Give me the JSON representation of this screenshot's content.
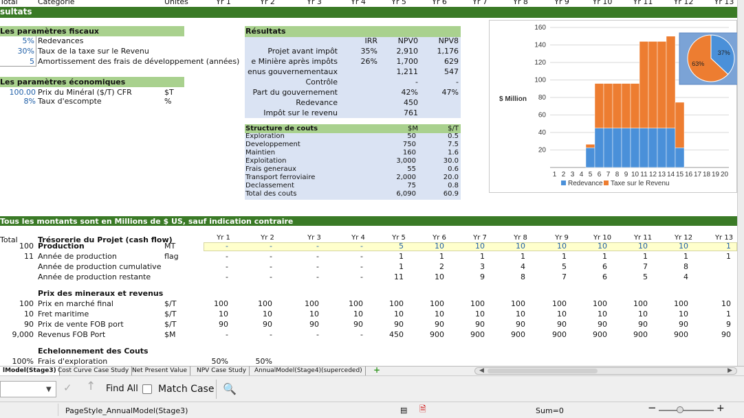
{
  "header_row": {
    "c0": "Total",
    "c1": "Catégorie",
    "c2": "Unités",
    "years": [
      "Yr 1",
      "Yr 2",
      "Yr 3",
      "Yr 4",
      "Yr 5",
      "Yr 6",
      "Yr 7",
      "Yr 8",
      "Yr 9",
      "Yr 10",
      "Yr 11",
      "Yr 12",
      "Yr 13"
    ]
  },
  "sheet": {
    "section_title": "sultats",
    "units_note": "Tous les montants sont en Millions de $ US, sauf indication contraire"
  },
  "fiscal": {
    "title": "Les paramètres fiscaux",
    "rows": [
      {
        "value": "5%",
        "label": "Redevances"
      },
      {
        "value": "30%",
        "label": "Taux de la taxe sur le Revenu"
      },
      {
        "value": "5",
        "label": "Amortissement des frais de développement (années)"
      }
    ]
  },
  "economic": {
    "title": "Les paramètres économiques",
    "rows": [
      {
        "value": "100.00",
        "label": "Prix du Minéral ($/T) CFR",
        "unit": "$T"
      },
      {
        "value": "8%",
        "label": "Taux d'escompte",
        "unit": "%"
      }
    ]
  },
  "results": {
    "title": "Résultats",
    "headers": [
      "IRR",
      "NPV0",
      "NPV8"
    ],
    "rows": [
      {
        "label": "Projet avant impôt",
        "irr": "35%",
        "npv0": "2,910",
        "npv8": "1,176"
      },
      {
        "label": "e Minière après impôts",
        "irr": "26%",
        "npv0": "1,700",
        "npv8": "629"
      },
      {
        "label": "enus gouvernementaux",
        "irr": "",
        "npv0": "1,211",
        "npv8": "547"
      },
      {
        "label": "Contrôle",
        "irr": "",
        "npv0": "-",
        "npv8": "-"
      },
      {
        "label": "Part du gouvernement",
        "irr": "",
        "npv0": "42%",
        "npv8": "47%"
      },
      {
        "label": "Redevance",
        "irr": "",
        "npv0": "450",
        "npv8": ""
      },
      {
        "label": "Impôt sur le revenu",
        "irr": "",
        "npv0": "761",
        "npv8": ""
      }
    ]
  },
  "costs": {
    "title": "Structure de couts",
    "headers": [
      "$M",
      "$/T"
    ],
    "rows": [
      {
        "label": "Exploration",
        "m": "50",
        "t": "0.5"
      },
      {
        "label": "Developpement",
        "m": "750",
        "t": "7.5"
      },
      {
        "label": "Maintien",
        "m": "160",
        "t": "1.6"
      },
      {
        "label": "Exploitation",
        "m": "3,000",
        "t": "30.0"
      },
      {
        "label": "Frais generaux",
        "m": "55",
        "t": "0.6"
      },
      {
        "label": "Transport ferroviaire",
        "m": "2,000",
        "t": "20.0"
      },
      {
        "label": "Declassement",
        "m": "75",
        "t": "0.8"
      },
      {
        "label": "Total des couts",
        "m": "6,090",
        "t": "60.9"
      }
    ]
  },
  "cashflow": {
    "title": "Trésorerie du Projet (cash flow)",
    "total_header": "Total",
    "rows": [
      {
        "total": "100",
        "label": "Production",
        "unit": "MT",
        "bold": true,
        "yellow": true,
        "values": [
          "-",
          "-",
          "-",
          "-",
          "5",
          "10",
          "10",
          "10",
          "10",
          "10",
          "10",
          "10",
          "1"
        ]
      },
      {
        "total": "11",
        "label": "Année de production",
        "unit": "flag",
        "values": [
          "-",
          "-",
          "-",
          "-",
          "1",
          "1",
          "1",
          "1",
          "1",
          "1",
          "1",
          "1",
          "1"
        ]
      },
      {
        "total": "",
        "label": "Année de production cumulative",
        "unit": "",
        "values": [
          "-",
          "-",
          "-",
          "-",
          "1",
          "2",
          "3",
          "4",
          "5",
          "6",
          "7",
          "8",
          ""
        ]
      },
      {
        "total": "",
        "label": "Année de production restante",
        "unit": "",
        "values": [
          "-",
          "-",
          "-",
          "-",
          "11",
          "10",
          "9",
          "8",
          "7",
          "6",
          "5",
          "4",
          ""
        ]
      },
      {
        "total": "",
        "label": "Prix des mineraux et revenus",
        "unit": "",
        "bold": true,
        "values": []
      },
      {
        "total": "100",
        "label": "Prix en marché final",
        "unit": "$/T",
        "values": [
          "100",
          "100",
          "100",
          "100",
          "100",
          "100",
          "100",
          "100",
          "100",
          "100",
          "100",
          "100",
          "10"
        ]
      },
      {
        "total": "10",
        "label": "Fret maritime",
        "unit": "$/T",
        "values": [
          "10",
          "10",
          "10",
          "10",
          "10",
          "10",
          "10",
          "10",
          "10",
          "10",
          "10",
          "10",
          "1"
        ]
      },
      {
        "total": "90",
        "label": "Prix de vente FOB port",
        "unit": "$/T",
        "values": [
          "90",
          "90",
          "90",
          "90",
          "90",
          "90",
          "90",
          "90",
          "90",
          "90",
          "90",
          "90",
          "9"
        ]
      },
      {
        "total": "9,000",
        "label": "Revenus FOB Port",
        "unit": "$M",
        "values": [
          "-",
          "-",
          "-",
          "-",
          "450",
          "900",
          "900",
          "900",
          "900",
          "900",
          "900",
          "900",
          "90"
        ]
      },
      {
        "total": "",
        "label": "Echelonnement des Couts",
        "unit": "",
        "bold": true,
        "values": []
      },
      {
        "total": "100%",
        "label": "Frais d'exploration",
        "unit": "",
        "values": [
          "50%",
          "50%"
        ]
      }
    ]
  },
  "chart_data": {
    "type": "bar",
    "stacked": true,
    "title": "",
    "ylabel": "$ Million",
    "ylim": [
      0,
      160
    ],
    "yticks": [
      20,
      40,
      60,
      80,
      100,
      120,
      140,
      160
    ],
    "categories": [
      "1",
      "2",
      "3",
      "4",
      "5",
      "6",
      "7",
      "8",
      "9",
      "10",
      "11",
      "12",
      "13",
      "14",
      "15",
      "16",
      "17",
      "18",
      "19",
      "20"
    ],
    "series": [
      {
        "name": "Redevance",
        "color": "#4a90d9",
        "values": [
          0,
          0,
          0,
          0,
          22.5,
          45,
          45,
          45,
          45,
          45,
          45,
          45,
          45,
          45,
          22.5,
          0,
          0,
          0,
          0,
          0
        ]
      },
      {
        "name": "Taxe sur le Revenu",
        "color": "#ed7d31",
        "values": [
          0,
          0,
          0,
          0,
          4,
          51,
          51,
          51,
          51,
          51,
          99,
          99,
          99,
          105,
          52,
          0,
          0,
          0,
          0,
          0
        ]
      }
    ],
    "legend": "bottom",
    "grid": true,
    "pie": {
      "slices": [
        {
          "label": "37%",
          "value": 37,
          "color": "#4a90d9"
        },
        {
          "label": "63%",
          "value": 63,
          "color": "#ed7d31"
        }
      ]
    }
  },
  "tabs": [
    {
      "label": "lModel(Stage3)",
      "active": true
    },
    {
      "label": "Cost Curve Case Study"
    },
    {
      "label": "Net Present Value"
    },
    {
      "label": "NPV Case Study"
    },
    {
      "label": "AnnualModel(Stage4)(superceded)"
    }
  ],
  "toolbar": {
    "find_all": "Find All",
    "match_case": "Match Case"
  },
  "status": {
    "page_style": "PageStyle_AnnualModel(Stage3)",
    "sum": "Sum=0"
  }
}
